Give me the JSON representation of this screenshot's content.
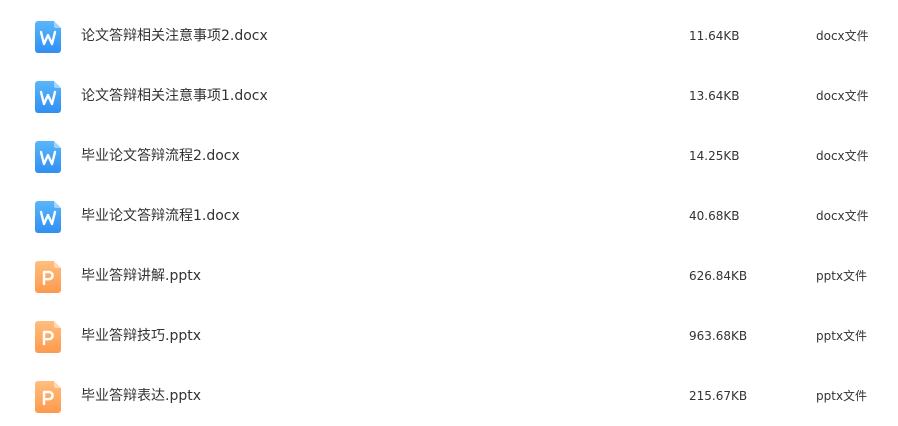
{
  "colors": {
    "docx_icon_top": "#5ab6fb",
    "docx_icon_bottom": "#2f8ff3",
    "pptx_icon_top": "#ffbe7e",
    "pptx_icon_bottom": "#fd9a4e"
  },
  "files": [
    {
      "name": "论文答辩相关注意事项2.docx",
      "size": "11.64KB",
      "type": "docx文件",
      "icon": "word-doc-icon"
    },
    {
      "name": "论文答辩相关注意事项1.docx",
      "size": "13.64KB",
      "type": "docx文件",
      "icon": "word-doc-icon"
    },
    {
      "name": "毕业论文答辩流程2.docx",
      "size": "14.25KB",
      "type": "docx文件",
      "icon": "word-doc-icon"
    },
    {
      "name": "毕业论文答辩流程1.docx",
      "size": "40.68KB",
      "type": "docx文件",
      "icon": "word-doc-icon"
    },
    {
      "name": "毕业答辩讲解.pptx",
      "size": "626.84KB",
      "type": "pptx文件",
      "icon": "powerpoint-icon"
    },
    {
      "name": "毕业答辩技巧.pptx",
      "size": "963.68KB",
      "type": "pptx文件",
      "icon": "powerpoint-icon"
    },
    {
      "name": "毕业答辩表达.pptx",
      "size": "215.67KB",
      "type": "pptx文件",
      "icon": "powerpoint-icon"
    }
  ]
}
